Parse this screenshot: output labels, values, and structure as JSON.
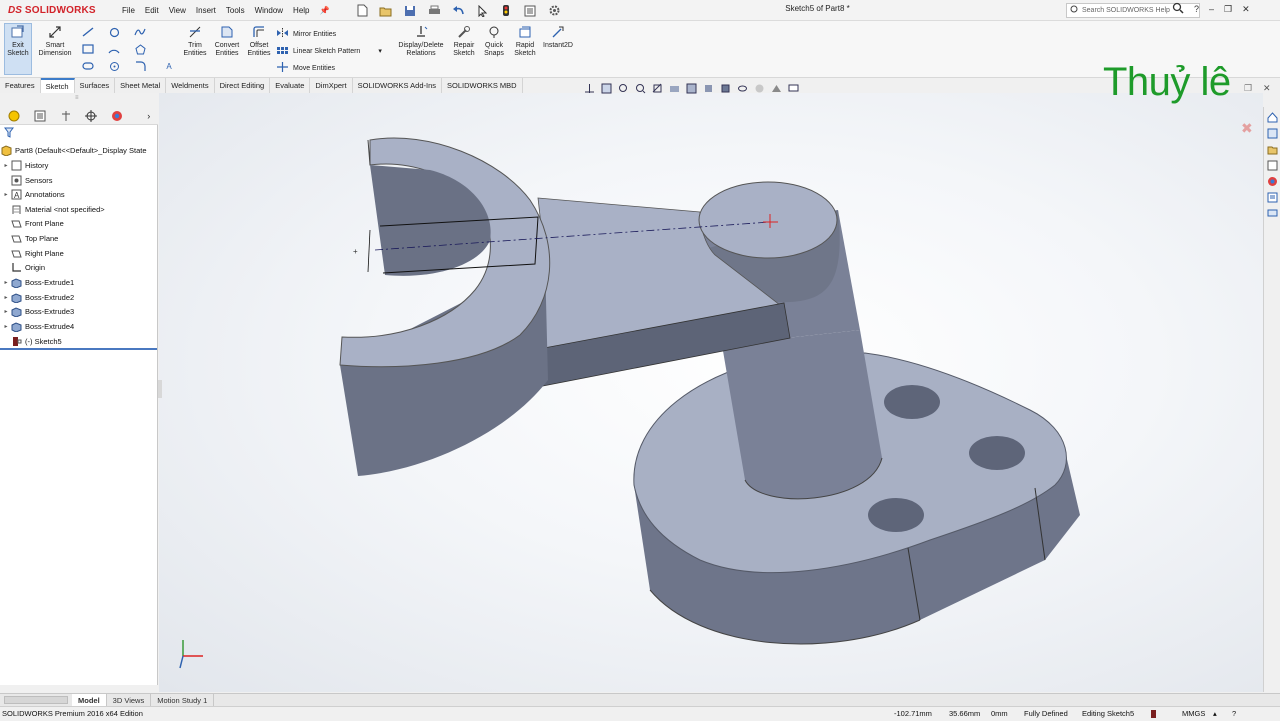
{
  "app": {
    "brand_ds": "DS",
    "brand_name": "SOLIDWORKS",
    "doc_title": "Sketch5 of Part8 *",
    "search_placeholder": "Search SOLIDWORKS Help",
    "menu": [
      "File",
      "Edit",
      "View",
      "Insert",
      "Tools",
      "Window",
      "Help"
    ]
  },
  "ribbon": {
    "exit_sketch": "Exit Sketch",
    "smart_dimension": "Smart Dimension",
    "trim_entities": "Trim Entities",
    "convert_entities": "Convert Entities",
    "offset_entities": "Offset Entities",
    "mirror_entities": "Mirror Entities",
    "linear_sketch_pattern": "Linear Sketch Pattern",
    "move_entities": "Move Entities",
    "display_delete_relations": "Display/Delete Relations",
    "repair_sketch": "Repair Sketch",
    "quick_snaps": "Quick Snaps",
    "rapid_sketch": "Rapid Sketch",
    "instant2d": "Instant2D"
  },
  "tabs": [
    "Features",
    "Sketch",
    "Surfaces",
    "Sheet Metal",
    "Weldments",
    "Direct Editing",
    "Evaluate",
    "DimXpert",
    "SOLIDWORKS Add-Ins",
    "SOLIDWORKS MBD"
  ],
  "active_tab": "Sketch",
  "tree": {
    "root": "Part8  (Default<<Default>_Display State",
    "items": [
      "History",
      "Sensors",
      "Annotations",
      "Material <not specified>",
      "Front Plane",
      "Top Plane",
      "Right Plane",
      "Origin",
      "Boss-Extrude1",
      "Boss-Extrude2",
      "Boss-Extrude3",
      "Boss-Extrude4",
      "(-) Sketch5"
    ]
  },
  "watermark": "Thuỷ lê",
  "bottom_tabs": [
    "Model",
    "3D Views",
    "Motion Study 1"
  ],
  "status": {
    "edition": "SOLIDWORKS Premium 2016 x64 Edition",
    "x": "-102.71mm",
    "y": "35.66mm",
    "z": "0mm",
    "state": "Fully Defined",
    "editing": "Editing Sketch5",
    "units": "MMGS"
  },
  "colors": {
    "accent": "#3d7cc9",
    "brand": "#d2232a",
    "watermark": "#1e9b2a",
    "model_face": "#a9b1c6",
    "model_side": "#6b7286"
  }
}
